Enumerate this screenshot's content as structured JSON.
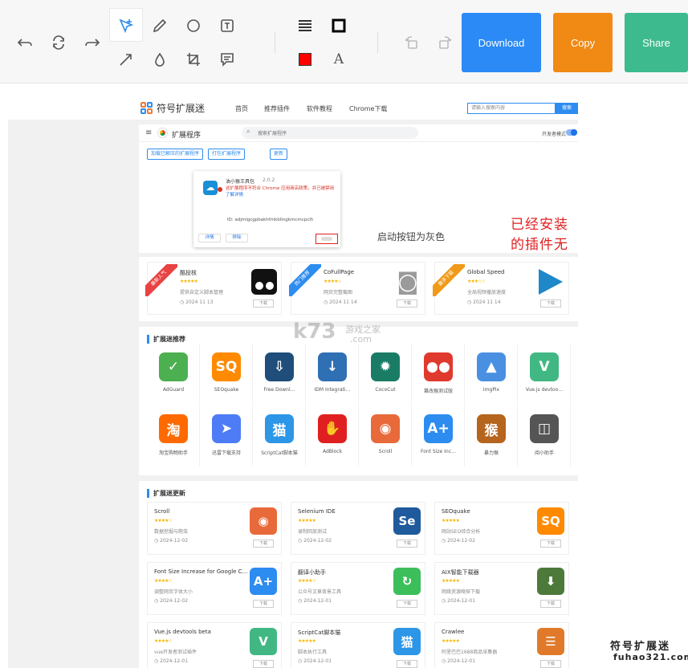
{
  "toolbar": {
    "download_label": "Download",
    "copy_label": "Copy",
    "share_label": "Share",
    "colors": {
      "download": "#2b8af5",
      "copy": "#f08a14",
      "share": "#3dbb8f",
      "stroke_color": "#ff0000"
    },
    "tools": [
      "undo-icon",
      "redo-cycle-icon",
      "redo-icon",
      "select-icon",
      "pencil-icon",
      "circle-icon",
      "text-box-icon",
      "arrow-icon",
      "drop-icon",
      "crop-icon",
      "comment-icon",
      "line-weight-icon",
      "border-box-icon",
      "color-swatch-icon",
      "font-size-icon",
      "rotate-left-icon",
      "rotate-right-icon"
    ]
  },
  "site": {
    "logo_text": "符号扩展迷",
    "nav": [
      "首页",
      "推荐插件",
      "软件教程",
      "Chrome下载"
    ],
    "search_placeholder": "请输入搜索内容",
    "search_button": "搜索"
  },
  "extensions_page": {
    "title": "扩展程序",
    "search_text": "搜索扩展程序",
    "dev_mode_label": "开发者模式",
    "chips": [
      "加载已解压的扩展程序",
      "打包扩展程序",
      "更新"
    ],
    "card": {
      "name": "油小猴王具包",
      "version": "2.0.2",
      "warning": "这扩展程序不符合 Chrome 应用商店政策，并已被禁用",
      "warning_link": "了解详情",
      "id_text": "ID: adjmlgcgpbakhfmkbllngkmcmcpclh",
      "details_button": "详情",
      "remove_button": "移除"
    },
    "annotation_main": "已经安装的插件无法启动",
    "annotation_sub": "启动按钮为灰色"
  },
  "featured": [
    {
      "ribbon": "最新人气",
      "ribbon_color": "#e94242",
      "name": "酷投核",
      "desc": "提供自定义脚本管理",
      "date": "2024 11 13",
      "download": "下载",
      "icon": "tm-icon",
      "icon_color": "#111"
    },
    {
      "ribbon": "热门推荐",
      "ribbon_color": "#2d8cf0",
      "name": "CoFullPage",
      "desc": "网页完整截图",
      "date": "2024 11 14",
      "download": "下载",
      "icon": "camera-icon",
      "icon_color": "#9a9a9a"
    },
    {
      "ribbon": "最多下载",
      "ribbon_color": "#f09a1a",
      "name": "Global Speed",
      "desc": "全局视频播放速度",
      "date": "2024 11 14",
      "download": "下载",
      "icon": "play-icon",
      "icon_color": "#1e88c8"
    }
  ],
  "recommend": {
    "title": "扩展迷推荐",
    "items": [
      {
        "label": "AdGuard",
        "glyph": "✓",
        "color": "#4caf50"
      },
      {
        "label": "SEOquake",
        "glyph": "SQ",
        "color": "#ff8a00"
      },
      {
        "label": "Free Downl…",
        "glyph": "⇩",
        "color": "#1e4e79"
      },
      {
        "label": "IDM Integrati…",
        "glyph": "↓",
        "color": "#2f6fb4"
      },
      {
        "label": "CocoCut",
        "glyph": "✹",
        "color": "#1b7c66"
      },
      {
        "label": "篡改猴测试版",
        "glyph": "●●",
        "color": "#e03a2e"
      },
      {
        "label": "ImgPix",
        "glyph": "▲",
        "color": "#4a90e2"
      },
      {
        "label": "Vue.js devtoo…",
        "glyph": "V",
        "color": "#41b883"
      },
      {
        "label": "淘宝购物助手",
        "glyph": "淘",
        "color": "#ff6a00"
      },
      {
        "label": "迅雷下载支持",
        "glyph": "➤",
        "color": "#4d7cf6"
      },
      {
        "label": "ScriptCat脚本猫",
        "glyph": "猫",
        "color": "#2d96e6"
      },
      {
        "label": "AdBlock",
        "glyph": "✋",
        "color": "#e02020"
      },
      {
        "label": "Scroll",
        "glyph": "◉",
        "color": "#e86a3a"
      },
      {
        "label": "Font Size Inc…",
        "glyph": "A+",
        "color": "#2d8cf0"
      },
      {
        "label": "暴力猴",
        "glyph": "猴",
        "color": "#b5651d"
      },
      {
        "label": "阅小助手",
        "glyph": "◫",
        "color": "#555"
      }
    ]
  },
  "updates": {
    "title": "扩展迷更新",
    "items": [
      {
        "name": "Scroll",
        "desc": "数据挖掘与爬虫",
        "date": "2024-12-02",
        "download": "下载",
        "glyph": "◉",
        "color": "#e86a3a"
      },
      {
        "name": "Selenium IDE",
        "desc": "录制回放测试",
        "date": "2024-12-02",
        "download": "下载",
        "glyph": "Se",
        "color": "#1e5a9c"
      },
      {
        "name": "SEOquake",
        "desc": "网站SEO综合分析",
        "date": "2024-12-02",
        "download": "下载",
        "glyph": "SQ",
        "color": "#ff8a00"
      },
      {
        "name": "Font Size Increase for Google C…",
        "desc": "调整网页字体大小",
        "date": "2024-12-02",
        "download": "下载",
        "glyph": "A+",
        "color": "#2d8cf0"
      },
      {
        "name": "翻译小助手",
        "desc": "公众号文章背景工具",
        "date": "2024-12-01",
        "download": "下载",
        "glyph": "↻",
        "color": "#3cbf5a"
      },
      {
        "name": "AIX智能下载器",
        "desc": "网络资源嗅探下载",
        "date": "2024-12-01",
        "download": "下载",
        "glyph": "⬇",
        "color": "#4d7a3a"
      },
      {
        "name": "Vue.js devtools beta",
        "desc": "vue开发者测试插件",
        "date": "2024-12-01",
        "download": "下载",
        "glyph": "V",
        "color": "#41b883"
      },
      {
        "name": "ScriptCat脚本猫",
        "desc": "脚本执行工具",
        "date": "2024-12-01",
        "download": "下载",
        "glyph": "猫",
        "color": "#2d96e6"
      },
      {
        "name": "Crawlee",
        "desc": "阿里巴巴1688商品采集器",
        "date": "2024-12-01",
        "download": "下载",
        "glyph": "☰",
        "color": "#e07a2a"
      }
    ]
  },
  "watermarks": {
    "k73": "k73",
    "k73_sub": "游戏之家",
    "k73_domain": ".com",
    "site_name": "符号扩展迷",
    "site_domain": "fuhao321.com"
  }
}
